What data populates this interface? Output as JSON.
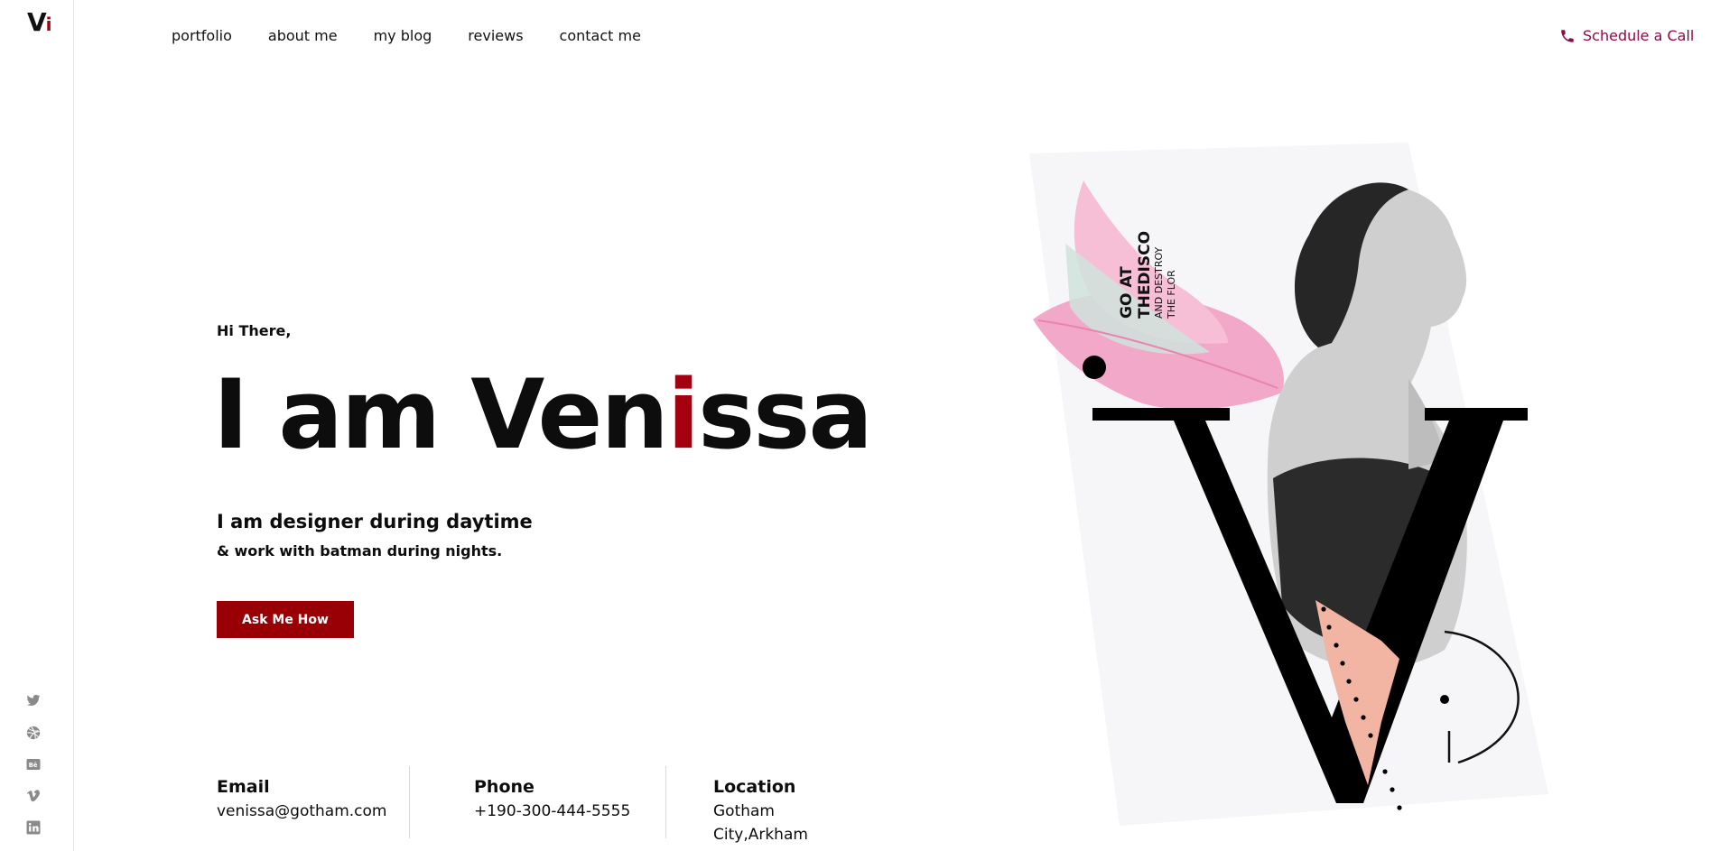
{
  "brand": {
    "logo_main": "V",
    "logo_accent": "i"
  },
  "nav": {
    "items": [
      "portfolio",
      "about me",
      "my blog",
      "reviews",
      "contact me"
    ]
  },
  "header": {
    "cta_label": "Schedule a Call"
  },
  "hero": {
    "greeting": "Hi There,",
    "headline_prefix": "I am Ven",
    "headline_highlight": "i",
    "headline_suffix": "ssa",
    "subtitle_1": "I am designer during daytime",
    "subtitle_2": "& work with batman during nights.",
    "button_label": "Ask Me How"
  },
  "contact": {
    "email_label": "Email",
    "email_value": "venissa@gotham.com",
    "phone_label": "Phone",
    "phone_value": "+190-300-444-5555",
    "location_label": "Location",
    "location_line1": "Gotham",
    "location_line2": "City,Arkham"
  },
  "art": {
    "line1": "GO AT",
    "line2": "THEDISCO",
    "line3": "AND DESTROY",
    "line4": "THE FLOR"
  },
  "social": [
    "twitter-icon",
    "dribbble-icon",
    "behance-icon",
    "vimeo-icon",
    "linkedin-icon"
  ],
  "colors": {
    "accent": "#a30010",
    "cta_text": "#8c0a45",
    "button_bg": "#980006"
  }
}
